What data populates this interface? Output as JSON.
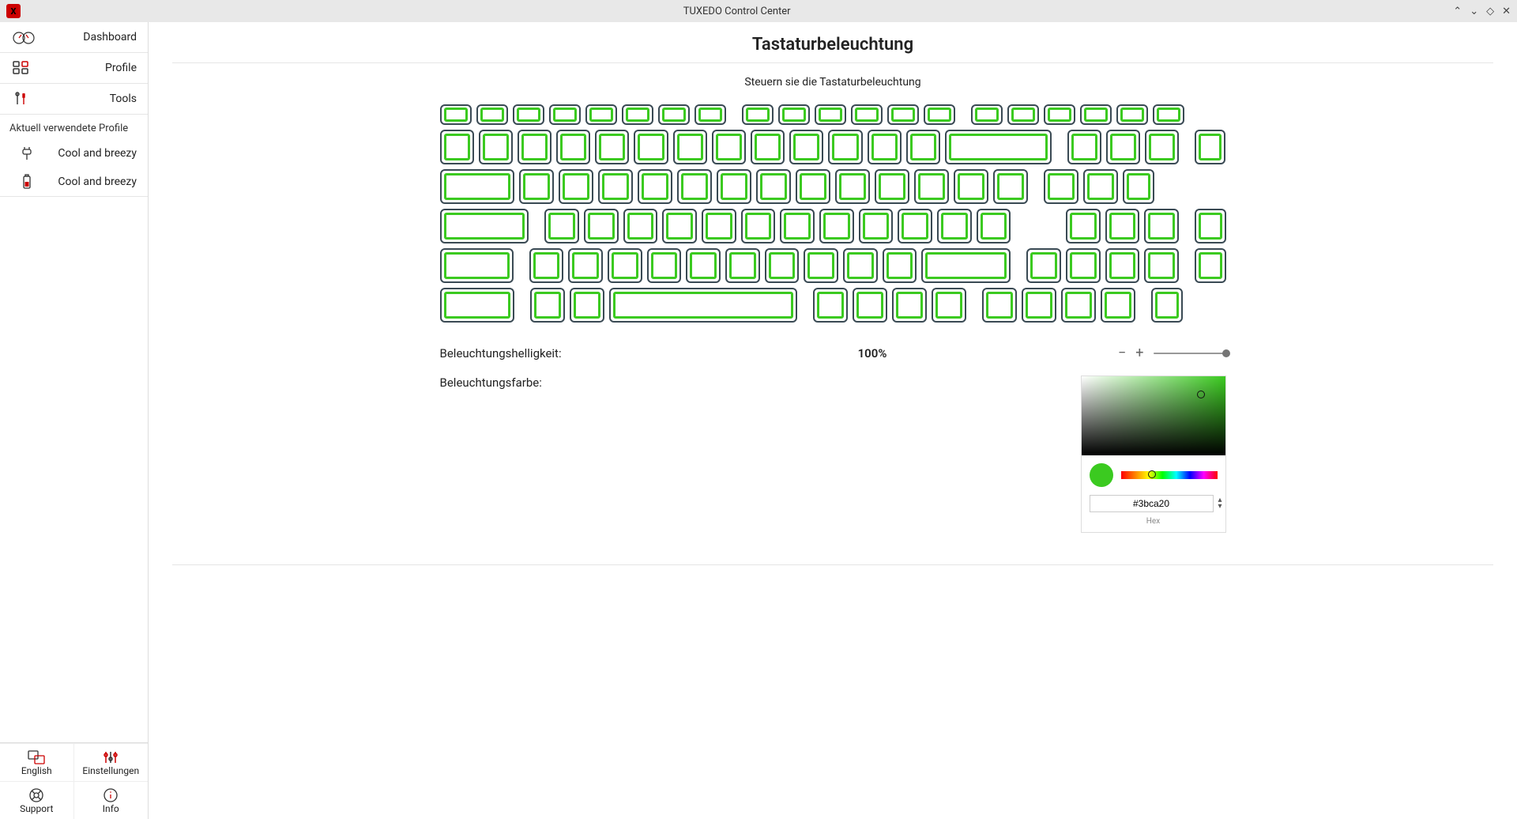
{
  "window": {
    "title": "TUXEDO Control Center"
  },
  "sidebar": {
    "items": [
      {
        "label": "Dashboard"
      },
      {
        "label": "Profile"
      },
      {
        "label": "Tools"
      }
    ],
    "section_label": "Aktuell verwendete Profile",
    "profiles": [
      {
        "label": "Cool and breezy"
      },
      {
        "label": "Cool and breezy"
      }
    ],
    "bottom": {
      "lang": "English",
      "settings": "Einstellungen",
      "support": "Support",
      "info": "Info"
    }
  },
  "main": {
    "title": "Tastaturbeleuchtung",
    "subtitle": "Steuern sie die Tastaturbeleuchtung",
    "brightness_label": "Beleuchtungshelligkeit:",
    "brightness_value": "100%",
    "color_label": "Beleuchtungsfarbe:",
    "key_color": "#3bca20",
    "hex_value": "#3bca20",
    "hex_label": "Hex"
  }
}
